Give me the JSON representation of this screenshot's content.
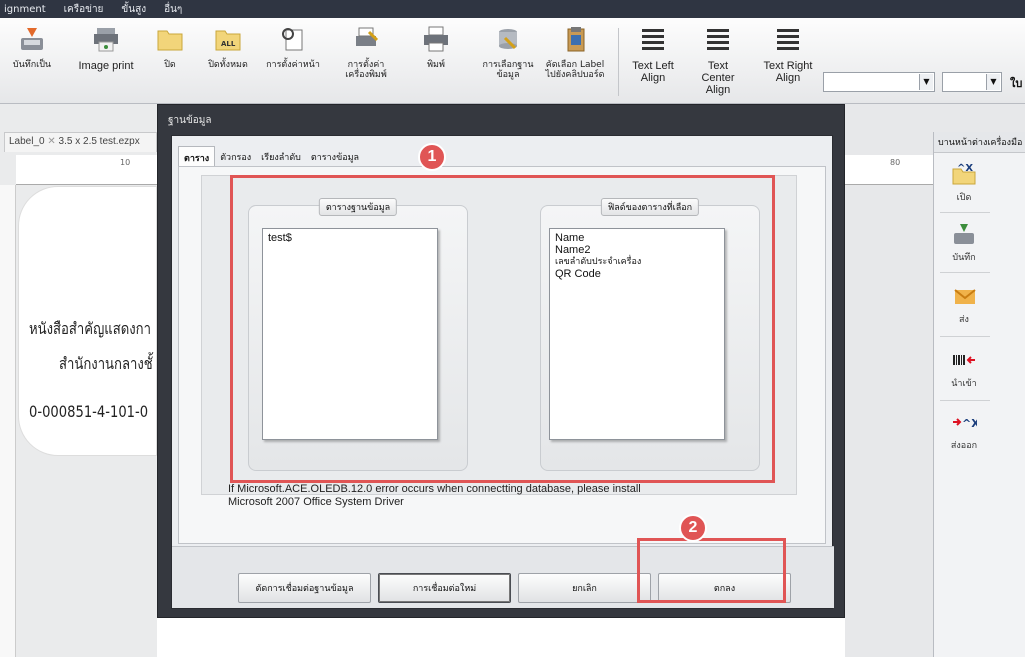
{
  "menubar": {
    "items": [
      "ignment",
      "เครือข่าย",
      "ขั้นสูง",
      "อื่นๆ"
    ]
  },
  "ribbon": {
    "buttons": [
      {
        "label": "บันทึกเป็น",
        "icon": "save-as-icon"
      },
      {
        "label": "Image print",
        "icon": "image-print-icon"
      },
      {
        "label": "ปิด",
        "icon": "folder-close-icon"
      },
      {
        "label": "ปิดทั้งหมด",
        "icon": "close-all-icon"
      },
      {
        "label": "การตั้งค่าหน้า",
        "icon": "page-setup-icon"
      },
      {
        "label": "การตั้งค่าเครื่องพิมพ์",
        "icon": "printer-setup-icon"
      },
      {
        "label": "พิมพ์",
        "icon": "print-icon"
      },
      {
        "label": "การเลือกฐานข้อมูล",
        "icon": "database-select-icon"
      },
      {
        "label": "คัดเลือก Label ไปยังคลิปบอร์ด",
        "icon": "clipboard-icon"
      }
    ],
    "align": [
      {
        "label": "Text Left Align",
        "icon": "align-left-icon"
      },
      {
        "label": "Text Center Align",
        "icon": "align-center-icon"
      },
      {
        "label": "Text Right Align",
        "icon": "align-right-icon"
      }
    ],
    "font_size_label": "ใบ"
  },
  "document": {
    "tab_name": "Label_0",
    "tab_title": "3.5 x 2.5 test.ezpx",
    "ruler_left": "10",
    "ruler_right": "80",
    "label_lines": [
      "หนังสือสำคัญแสดงกา",
      "สำนักงานกลางชั้",
      "0-000851-4-101-0"
    ]
  },
  "side_panel": {
    "title": "บานหน้าต่างเครื่องมือ",
    "buttons": [
      {
        "label": "เปิด",
        "icon": "open-icon"
      },
      {
        "label": "บันทึก",
        "icon": "save-icon"
      },
      {
        "label": "ส่ง",
        "icon": "send-icon"
      },
      {
        "label": "นำเข้า",
        "icon": "import-icon"
      },
      {
        "label": "ส่งออก",
        "icon": "export-icon"
      }
    ]
  },
  "dialog": {
    "title": "ฐานข้อมูล",
    "tabs": [
      "ตาราง",
      "ตัวกรอง",
      "เรียงลำดับ",
      "ตารางข้อมูล"
    ],
    "table_group": {
      "title": "ตารางฐานข้อมูล",
      "items": [
        "test$"
      ]
    },
    "field_group": {
      "title": "ฟิลด์ของตารางที่เลือก",
      "items": [
        "Name",
        "Name2",
        "เลขลำดับประจำเครื่อง",
        "QR Code"
      ]
    },
    "note_line1": "If Microsoft.ACE.OLEDB.12.0 error occurs when connectting database,  please install",
    "note_line2": "Microsoft 2007 Office System Driver",
    "buttons": {
      "disconnect": "ตัดการเชื่อมต่อฐานข้อมูล",
      "reconnect": "การเชื่อมต่อใหม่",
      "cancel": "ยกเลิก",
      "ok": "ตกลง"
    }
  },
  "annotations": {
    "marker1": "1",
    "marker2": "2",
    "color": "#e05555"
  }
}
